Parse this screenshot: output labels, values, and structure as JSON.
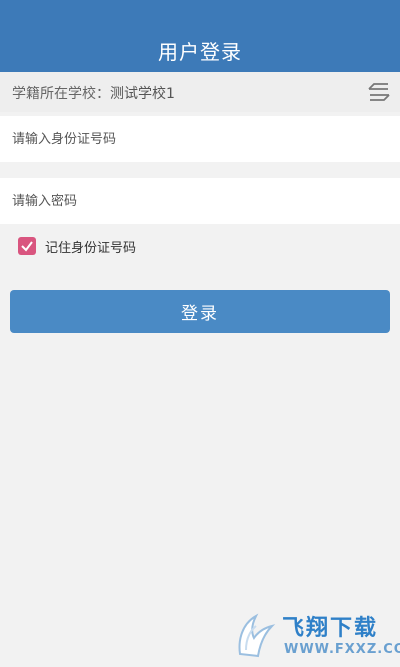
{
  "header": {
    "title": "用户登录",
    "background": "#3d7ab8"
  },
  "school": {
    "label": "学籍所在学校：",
    "name": "测试学校1",
    "switch_icon": "switch-school-icon"
  },
  "form": {
    "id_placeholder": "请输入身份证号码",
    "id_value": "",
    "password_placeholder": "请输入密码",
    "password_value": "",
    "remember_label": "记住身份证号码",
    "remember_checked": true,
    "remember_color": "#d9557f"
  },
  "login_button": {
    "label": "登录",
    "color": "#4a8ac5"
  },
  "watermark": {
    "brand": "飞翔下载",
    "url": "WWW.FXXZ.COM"
  }
}
